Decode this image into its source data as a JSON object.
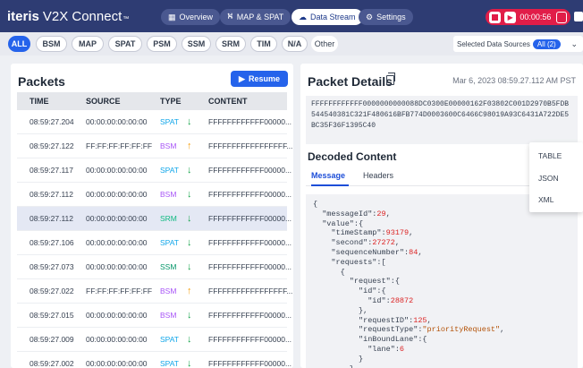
{
  "app": {
    "brand_bold": "iteris",
    "brand_rest": "V2X Connect",
    "tm": "™"
  },
  "nav": [
    {
      "label": "Overview",
      "icon": "grid-icon"
    },
    {
      "label": "MAP & SPAT",
      "icon": "map-icon"
    },
    {
      "label": "Data Stream",
      "icon": "cloud-icon",
      "active": true
    },
    {
      "label": "Settings",
      "icon": "gear-icon"
    }
  ],
  "recorder": {
    "time": "00:00:56"
  },
  "filters": [
    "ALL",
    "BSM",
    "MAP",
    "SPAT",
    "PSM",
    "SSM",
    "SRM",
    "TIM",
    "N/A",
    "Other"
  ],
  "selected_sources": {
    "label": "Selected Data Sources",
    "badge": "All (2)"
  },
  "packets": {
    "title": "Packets",
    "resume": "Resume",
    "columns": [
      "TIME",
      "SOURCE",
      "TYPE",
      "CONTENT"
    ],
    "rows": [
      {
        "time": "08:59:27.204",
        "source": "00:00:00:00:00:00",
        "type": "SPAT",
        "dir": "↓",
        "content": "FFFFFFFFFFFF00000..."
      },
      {
        "time": "08:59:27.122",
        "source": "FF:FF:FF:FF:FF:FF",
        "type": "BSM",
        "dir": "↑",
        "content": "FFFFFFFFFFFFFFFFF..."
      },
      {
        "time": "08:59:27.117",
        "source": "00:00:00:00:00:00",
        "type": "SPAT",
        "dir": "↓",
        "content": "FFFFFFFFFFFF00000..."
      },
      {
        "time": "08:59:27.112",
        "source": "00:00:00:00:00:00",
        "type": "BSM",
        "dir": "↓",
        "content": "FFFFFFFFFFFF00000..."
      },
      {
        "time": "08:59:27.112",
        "source": "00:00:00:00:00:00",
        "type": "SRM",
        "dir": "↓",
        "content": "FFFFFFFFFFFF00000..."
      },
      {
        "time": "08:59:27.106",
        "source": "00:00:00:00:00:00",
        "type": "SPAT",
        "dir": "↓",
        "content": "FFFFFFFFFFFF00000..."
      },
      {
        "time": "08:59:27.073",
        "source": "00:00:00:00:00:00",
        "type": "SSM",
        "dir": "↓",
        "content": "FFFFFFFFFFFF00000..."
      },
      {
        "time": "08:59:27.022",
        "source": "FF:FF:FF:FF:FF:FF",
        "type": "BSM",
        "dir": "↑",
        "content": "FFFFFFFFFFFFFFFFF..."
      },
      {
        "time": "08:59:27.015",
        "source": "00:00:00:00:00:00",
        "type": "BSM",
        "dir": "↓",
        "content": "FFFFFFFFFFFF00000..."
      },
      {
        "time": "08:59:27.009",
        "source": "00:00:00:00:00:00",
        "type": "SPAT",
        "dir": "↓",
        "content": "FFFFFFFFFFFF00000..."
      },
      {
        "time": "08:59:27.002",
        "source": "00:00:00:00:00:00",
        "type": "SPAT",
        "dir": "↓",
        "content": "FFFFFFFFFFFF00000..."
      }
    ]
  },
  "details": {
    "title": "Packet Details",
    "date": "Mar 6, 2023 08:59.27.112 AM PST",
    "hex": "FFFFFFFFFFFF0000000000088DC0300E00000162F03802C001D2970B5FDB544540381C321F480616BFB774D0003600C6466C98019A93C6431A722DE5BC35F36F1395C40",
    "decoded_title": "Decoded Content",
    "tabs": [
      "Message",
      "Headers"
    ]
  },
  "menu": [
    "TABLE",
    "JSON",
    "XML"
  ]
}
